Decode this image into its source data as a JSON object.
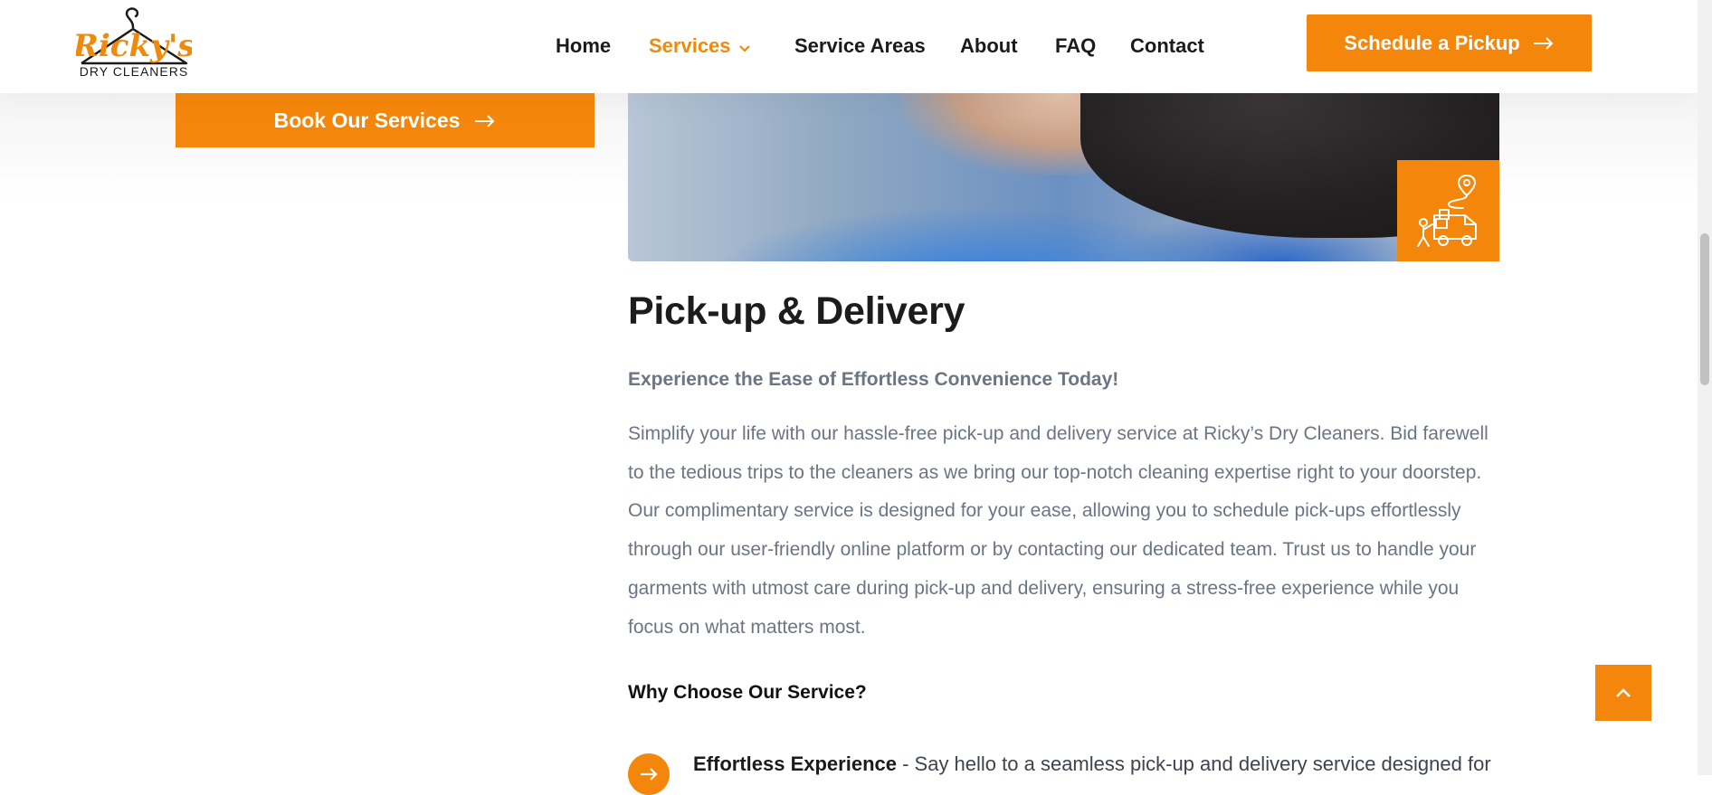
{
  "logo": {
    "brand": "Ricky's",
    "tagline": "DRY CLEANERS"
  },
  "nav": {
    "items": [
      {
        "label": "Home",
        "active": false
      },
      {
        "label": "Services",
        "active": true,
        "has_dropdown": true
      },
      {
        "label": "Service Areas",
        "active": false
      },
      {
        "label": "About",
        "active": false
      },
      {
        "label": "FAQ",
        "active": false
      },
      {
        "label": "Contact",
        "active": false
      }
    ],
    "cta": "Schedule a Pickup"
  },
  "sidebar": {
    "book_button": "Book Our Services"
  },
  "hero": {
    "badge_icon": "delivery-van-icon"
  },
  "content": {
    "title": "Pick-up & Delivery",
    "subtitle": "Experience the Ease of Effortless Convenience Today!",
    "body": "Simplify your life with our hassle-free pick-up and delivery service at Ricky’s Dry Cleaners. Bid farewell to the tedious trips to the cleaners as we bring our top-notch cleaning expertise right to your doorstep. Our complimentary service is designed for your ease, allowing you to schedule pick-ups effortlessly through our user-friendly online platform or by contacting our dedicated team. Trust us to handle your garments with utmost care during pick-up and delivery, ensuring a stress-free experience while you focus on what matters most.",
    "why_heading": "Why Choose Our Service?",
    "features": [
      {
        "title": "Effortless Experience",
        "text": " - Say hello to a seamless pick-up and delivery service designed for"
      }
    ]
  },
  "colors": {
    "accent": "#f4870b",
    "heading": "#1c1c1c",
    "body": "#6b7584"
  }
}
